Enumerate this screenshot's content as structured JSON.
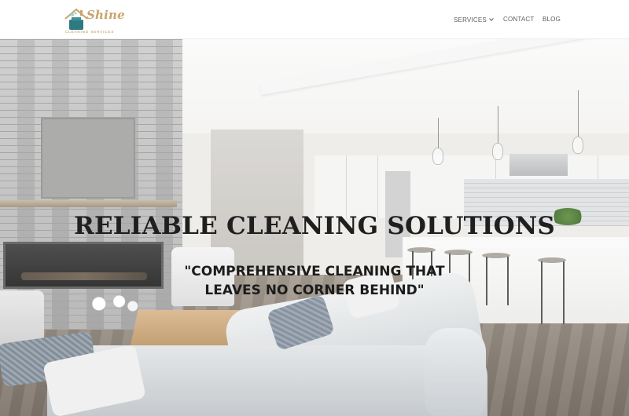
{
  "brand": {
    "name": "Shine",
    "tagline": "CLEANING SERVICES",
    "colors": {
      "gold": "#c9a46a",
      "teal": "#2f7a80"
    }
  },
  "nav": {
    "items": [
      {
        "label": "SERVICES",
        "has_dropdown": true,
        "icon": "chevron-down-icon"
      },
      {
        "label": "CONTACT"
      },
      {
        "label": "BLOG"
      }
    ]
  },
  "hero": {
    "title": "RELIABLE CLEANING SOLUTIONS",
    "subtitle": "\"COMPREHENSIVE CLEANING THAT LEAVES NO CORNER BEHIND\""
  }
}
